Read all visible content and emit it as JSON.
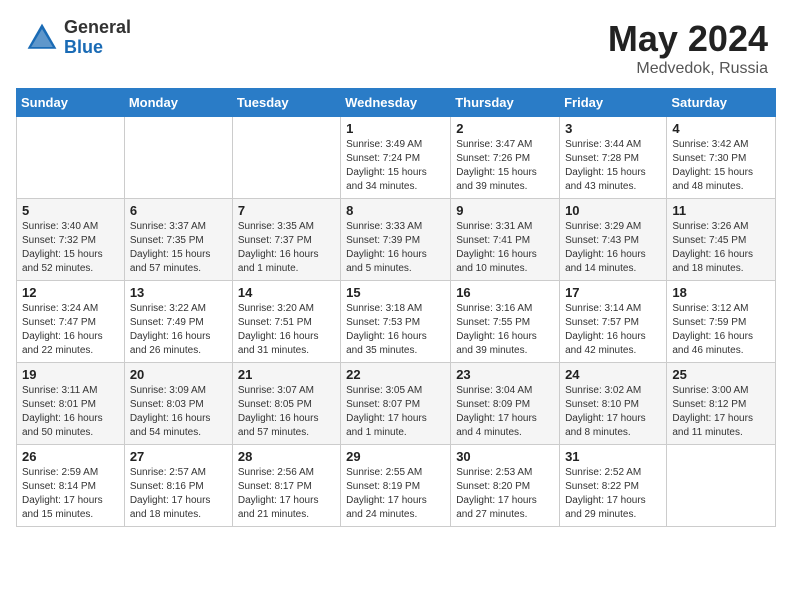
{
  "header": {
    "logo_general": "General",
    "logo_blue": "Blue",
    "title": "May 2024",
    "location": "Medvedok, Russia"
  },
  "weekdays": [
    "Sunday",
    "Monday",
    "Tuesday",
    "Wednesday",
    "Thursday",
    "Friday",
    "Saturday"
  ],
  "weeks": [
    [
      {
        "day": "",
        "sunrise": "",
        "sunset": "",
        "daylight": ""
      },
      {
        "day": "",
        "sunrise": "",
        "sunset": "",
        "daylight": ""
      },
      {
        "day": "",
        "sunrise": "",
        "sunset": "",
        "daylight": ""
      },
      {
        "day": "1",
        "sunrise": "Sunrise: 3:49 AM",
        "sunset": "Sunset: 7:24 PM",
        "daylight": "Daylight: 15 hours and 34 minutes."
      },
      {
        "day": "2",
        "sunrise": "Sunrise: 3:47 AM",
        "sunset": "Sunset: 7:26 PM",
        "daylight": "Daylight: 15 hours and 39 minutes."
      },
      {
        "day": "3",
        "sunrise": "Sunrise: 3:44 AM",
        "sunset": "Sunset: 7:28 PM",
        "daylight": "Daylight: 15 hours and 43 minutes."
      },
      {
        "day": "4",
        "sunrise": "Sunrise: 3:42 AM",
        "sunset": "Sunset: 7:30 PM",
        "daylight": "Daylight: 15 hours and 48 minutes."
      }
    ],
    [
      {
        "day": "5",
        "sunrise": "Sunrise: 3:40 AM",
        "sunset": "Sunset: 7:32 PM",
        "daylight": "Daylight: 15 hours and 52 minutes."
      },
      {
        "day": "6",
        "sunrise": "Sunrise: 3:37 AM",
        "sunset": "Sunset: 7:35 PM",
        "daylight": "Daylight: 15 hours and 57 minutes."
      },
      {
        "day": "7",
        "sunrise": "Sunrise: 3:35 AM",
        "sunset": "Sunset: 7:37 PM",
        "daylight": "Daylight: 16 hours and 1 minute."
      },
      {
        "day": "8",
        "sunrise": "Sunrise: 3:33 AM",
        "sunset": "Sunset: 7:39 PM",
        "daylight": "Daylight: 16 hours and 5 minutes."
      },
      {
        "day": "9",
        "sunrise": "Sunrise: 3:31 AM",
        "sunset": "Sunset: 7:41 PM",
        "daylight": "Daylight: 16 hours and 10 minutes."
      },
      {
        "day": "10",
        "sunrise": "Sunrise: 3:29 AM",
        "sunset": "Sunset: 7:43 PM",
        "daylight": "Daylight: 16 hours and 14 minutes."
      },
      {
        "day": "11",
        "sunrise": "Sunrise: 3:26 AM",
        "sunset": "Sunset: 7:45 PM",
        "daylight": "Daylight: 16 hours and 18 minutes."
      }
    ],
    [
      {
        "day": "12",
        "sunrise": "Sunrise: 3:24 AM",
        "sunset": "Sunset: 7:47 PM",
        "daylight": "Daylight: 16 hours and 22 minutes."
      },
      {
        "day": "13",
        "sunrise": "Sunrise: 3:22 AM",
        "sunset": "Sunset: 7:49 PM",
        "daylight": "Daylight: 16 hours and 26 minutes."
      },
      {
        "day": "14",
        "sunrise": "Sunrise: 3:20 AM",
        "sunset": "Sunset: 7:51 PM",
        "daylight": "Daylight: 16 hours and 31 minutes."
      },
      {
        "day": "15",
        "sunrise": "Sunrise: 3:18 AM",
        "sunset": "Sunset: 7:53 PM",
        "daylight": "Daylight: 16 hours and 35 minutes."
      },
      {
        "day": "16",
        "sunrise": "Sunrise: 3:16 AM",
        "sunset": "Sunset: 7:55 PM",
        "daylight": "Daylight: 16 hours and 39 minutes."
      },
      {
        "day": "17",
        "sunrise": "Sunrise: 3:14 AM",
        "sunset": "Sunset: 7:57 PM",
        "daylight": "Daylight: 16 hours and 42 minutes."
      },
      {
        "day": "18",
        "sunrise": "Sunrise: 3:12 AM",
        "sunset": "Sunset: 7:59 PM",
        "daylight": "Daylight: 16 hours and 46 minutes."
      }
    ],
    [
      {
        "day": "19",
        "sunrise": "Sunrise: 3:11 AM",
        "sunset": "Sunset: 8:01 PM",
        "daylight": "Daylight: 16 hours and 50 minutes."
      },
      {
        "day": "20",
        "sunrise": "Sunrise: 3:09 AM",
        "sunset": "Sunset: 8:03 PM",
        "daylight": "Daylight: 16 hours and 54 minutes."
      },
      {
        "day": "21",
        "sunrise": "Sunrise: 3:07 AM",
        "sunset": "Sunset: 8:05 PM",
        "daylight": "Daylight: 16 hours and 57 minutes."
      },
      {
        "day": "22",
        "sunrise": "Sunrise: 3:05 AM",
        "sunset": "Sunset: 8:07 PM",
        "daylight": "Daylight: 17 hours and 1 minute."
      },
      {
        "day": "23",
        "sunrise": "Sunrise: 3:04 AM",
        "sunset": "Sunset: 8:09 PM",
        "daylight": "Daylight: 17 hours and 4 minutes."
      },
      {
        "day": "24",
        "sunrise": "Sunrise: 3:02 AM",
        "sunset": "Sunset: 8:10 PM",
        "daylight": "Daylight: 17 hours and 8 minutes."
      },
      {
        "day": "25",
        "sunrise": "Sunrise: 3:00 AM",
        "sunset": "Sunset: 8:12 PM",
        "daylight": "Daylight: 17 hours and 11 minutes."
      }
    ],
    [
      {
        "day": "26",
        "sunrise": "Sunrise: 2:59 AM",
        "sunset": "Sunset: 8:14 PM",
        "daylight": "Daylight: 17 hours and 15 minutes."
      },
      {
        "day": "27",
        "sunrise": "Sunrise: 2:57 AM",
        "sunset": "Sunset: 8:16 PM",
        "daylight": "Daylight: 17 hours and 18 minutes."
      },
      {
        "day": "28",
        "sunrise": "Sunrise: 2:56 AM",
        "sunset": "Sunset: 8:17 PM",
        "daylight": "Daylight: 17 hours and 21 minutes."
      },
      {
        "day": "29",
        "sunrise": "Sunrise: 2:55 AM",
        "sunset": "Sunset: 8:19 PM",
        "daylight": "Daylight: 17 hours and 24 minutes."
      },
      {
        "day": "30",
        "sunrise": "Sunrise: 2:53 AM",
        "sunset": "Sunset: 8:20 PM",
        "daylight": "Daylight: 17 hours and 27 minutes."
      },
      {
        "day": "31",
        "sunrise": "Sunrise: 2:52 AM",
        "sunset": "Sunset: 8:22 PM",
        "daylight": "Daylight: 17 hours and 29 minutes."
      },
      {
        "day": "",
        "sunrise": "",
        "sunset": "",
        "daylight": ""
      }
    ]
  ]
}
